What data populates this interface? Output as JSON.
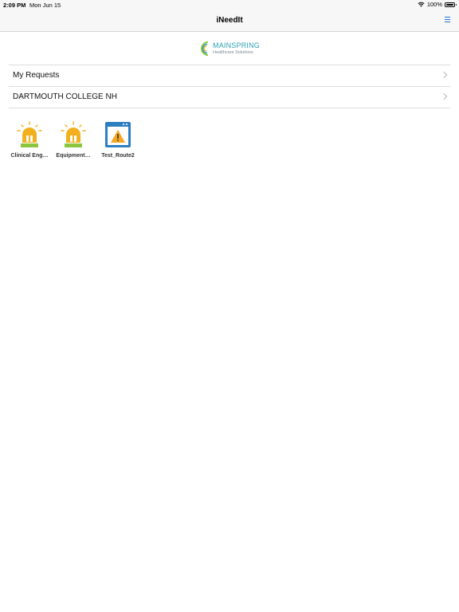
{
  "status_bar": {
    "time": "2:09 PM",
    "date": "Mon Jun 15",
    "battery": "100%"
  },
  "nav": {
    "title": "iNeedIt"
  },
  "logo": {
    "brand": "MAINSPRING",
    "subtitle": "Healthcare Solutions"
  },
  "rows": [
    {
      "label": "My Requests"
    },
    {
      "label": "DARTMOUTH COLLEGE NH"
    }
  ],
  "tiles": [
    {
      "label": "Clinical Eng…",
      "icon": "alarm-beacon-icon"
    },
    {
      "label": "Equipment…",
      "icon": "alarm-beacon-icon"
    },
    {
      "label": "Test_Route2",
      "icon": "warning-window-icon"
    }
  ],
  "colors": {
    "accent": "#1a73d9",
    "beacon": "#f2b01e",
    "beacon_base": "#8cc63f",
    "window": "#2d7fc1",
    "warning": "#f5a623"
  }
}
